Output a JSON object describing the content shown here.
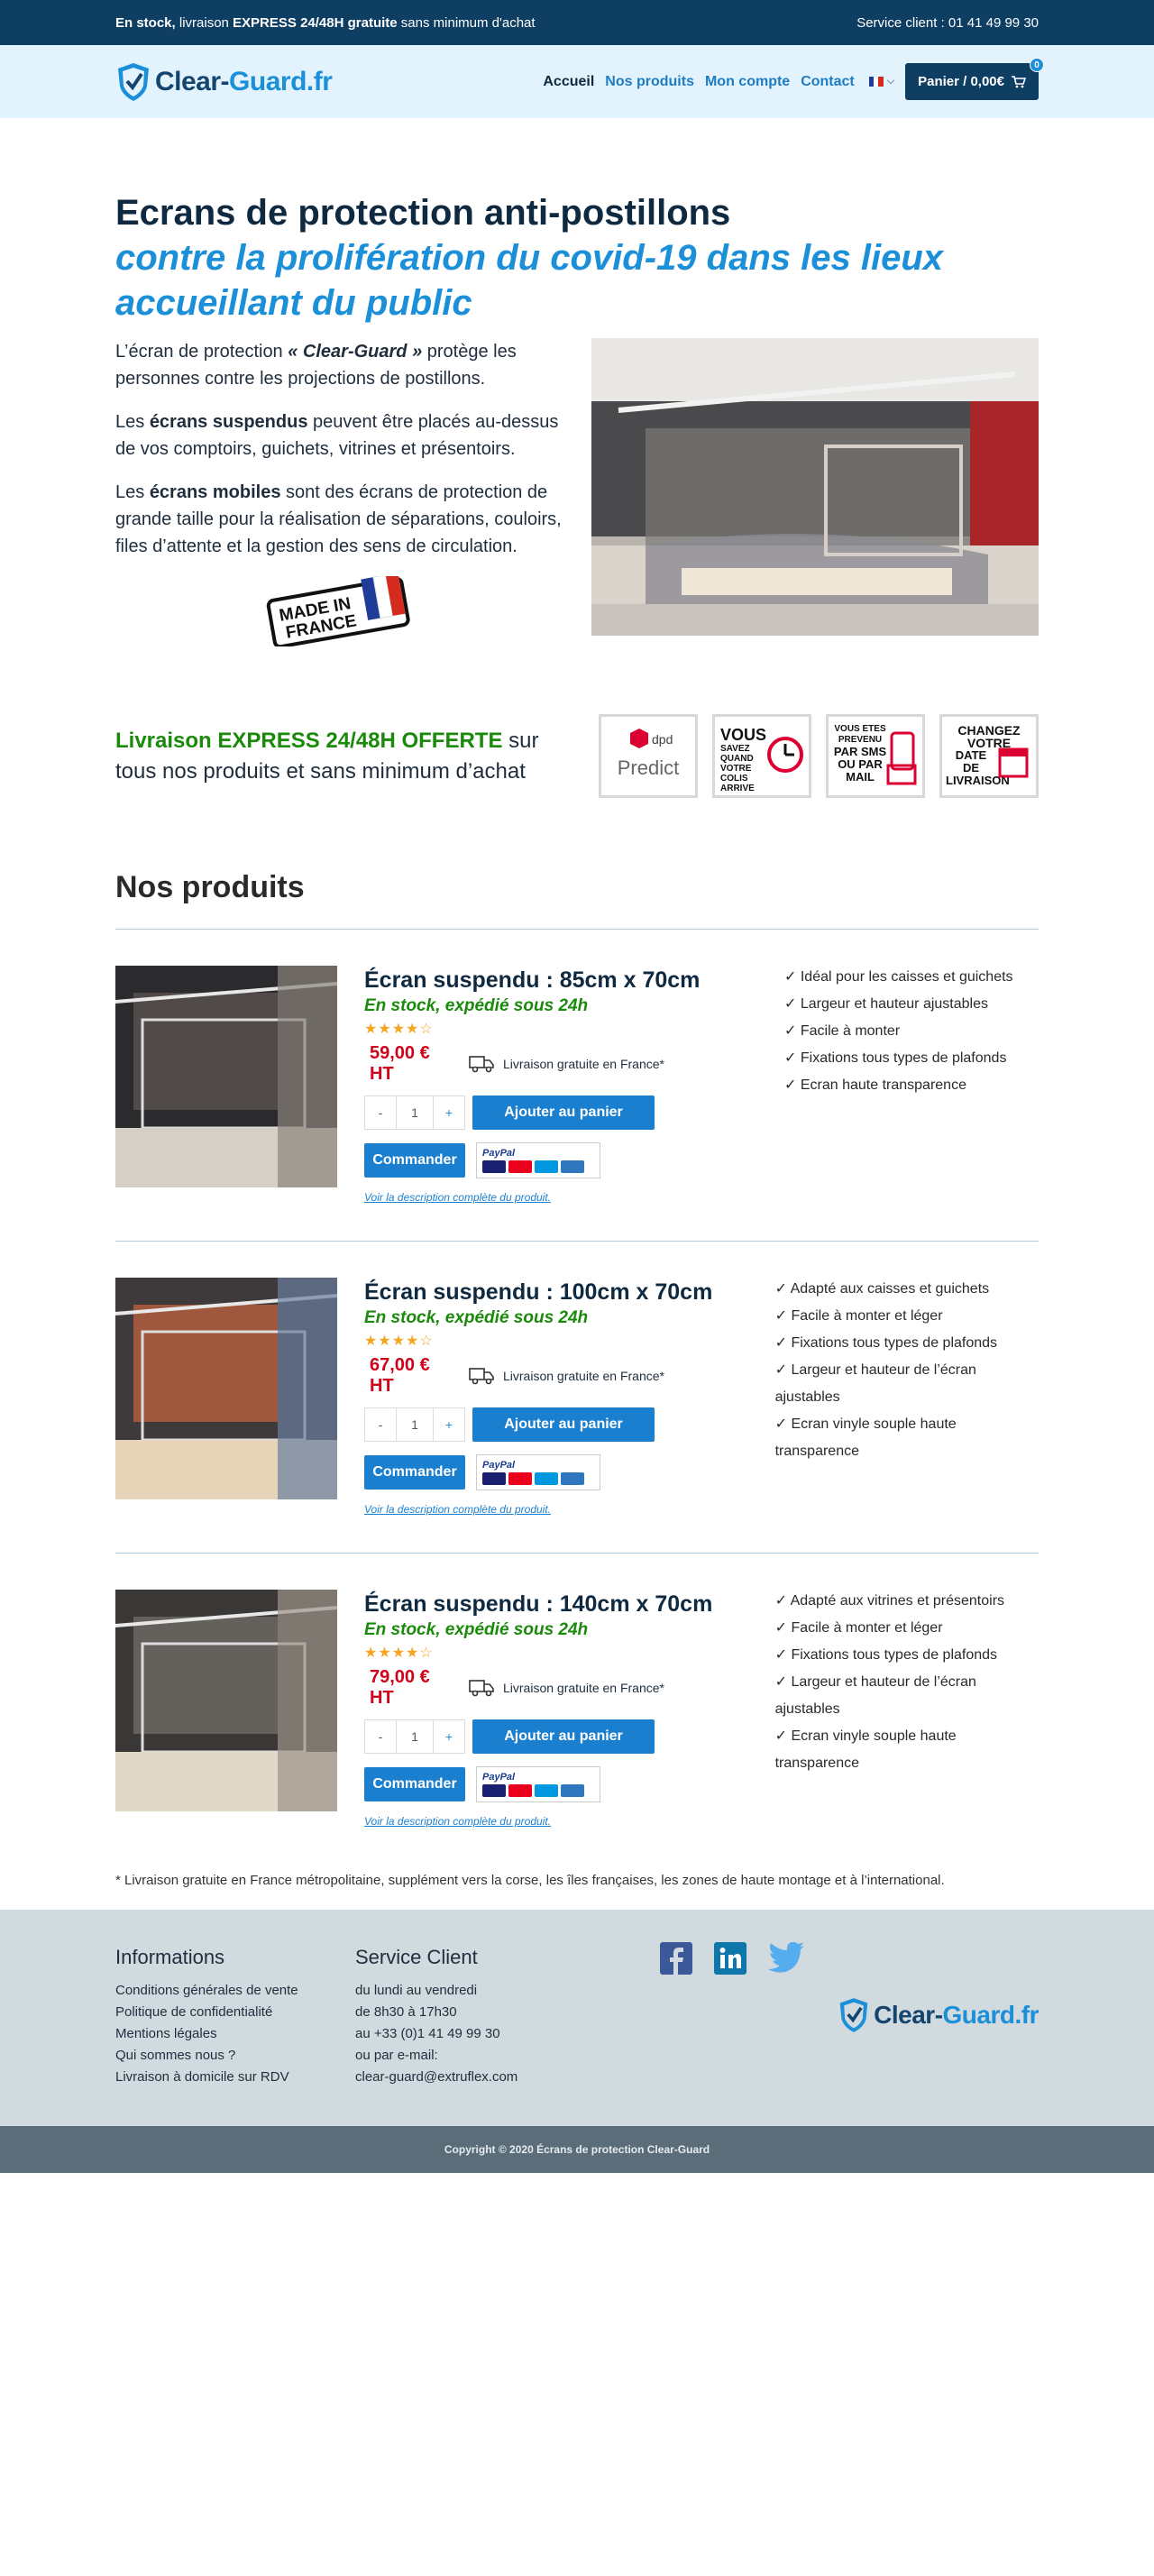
{
  "topbar": {
    "stock_bold": "En stock,",
    "stock_rest": " livraison ",
    "express": "EXPRESS 24/48H gratuite",
    "tail": " sans minimum d'achat",
    "service": "Service client : 01 41 49 99 30"
  },
  "header": {
    "logo_a": "Clear-",
    "logo_b": "Guard.fr",
    "nav": [
      "Accueil",
      "Nos produits",
      "Mon compte",
      "Contact"
    ],
    "cart_label": "Panier / 0,00€",
    "cart_count": "0"
  },
  "hero": {
    "title": "Ecrans de protection anti-postillons",
    "subtitle": "contre la prolifération du covid-19 dans les lieux accueillant du public",
    "p1_a": "L’écran de protection ",
    "p1_b": "« Clear-Guard »",
    "p1_c": " protège les personnes contre les projections de postillons.",
    "p2_a": "Les ",
    "p2_b": "écrans suspendus",
    "p2_c": " peuvent être placés au-dessus de vos comptoirs, guichets, vitrines et présentoirs.",
    "p3_a": "Les ",
    "p3_b": "écrans mobiles",
    "p3_c": " sont des écrans de protection de grande taille pour la réalisation de séparations, couloirs, files d’attente et la gestion des sens de circulation.",
    "madein_1": "MADE IN",
    "madein_2": "FRANCE"
  },
  "delivery": {
    "bold": "Livraison EXPRESS 24/48H OFFERTE",
    "rest": " sur tous nos produits et sans minimum d’achat",
    "badges": [
      {
        "l1": "dpd",
        "l2": "Predict"
      },
      {
        "l1": "VOUS",
        "l2": "SAVEZ QUAND VOTRE COLIS ARRIVE"
      },
      {
        "l1": "VOUS ETES PREVENU",
        "l2": "PAR SMS OU PAR MAIL"
      },
      {
        "l1": "CHANGEZ VOTRE",
        "l2": "DATE DE LIVRAISON"
      }
    ]
  },
  "products_title": "Nos produits",
  "products": [
    {
      "name": "Écran suspendu : 85cm x 70cm",
      "stock": "En stock, expédié sous 24h",
      "stars": "★★★★☆",
      "price": "59,00 € HT",
      "ship": "Livraison gratuite en France*",
      "qty": "1",
      "add": "Ajouter au panier",
      "order": "Commander",
      "link": "Voir la description complète du produit.",
      "features": [
        "Idéal pour les caisses et guichets",
        "Largeur et hauteur ajustables",
        "Facile à monter",
        "Fixations tous types de plafonds",
        "Ecran haute transparence"
      ]
    },
    {
      "name": "Écran suspendu : 100cm x 70cm",
      "stock": "En stock, expédié sous 24h",
      "stars": "★★★★☆",
      "price": "67,00 € HT",
      "ship": "Livraison gratuite en France*",
      "qty": "1",
      "add": "Ajouter au panier",
      "order": "Commander",
      "link": "Voir la description complète du produit.",
      "features": [
        "Adapté aux caisses et guichets",
        "Facile à monter et léger",
        "Fixations tous types de plafonds",
        "Largeur et hauteur de l’écran ajustables",
        "Ecran vinyle souple haute transparence"
      ]
    },
    {
      "name": "Écran suspendu : 140cm x 70cm",
      "stock": "En stock, expédié sous 24h",
      "stars": "★★★★☆",
      "price": "79,00 € HT",
      "ship": "Livraison gratuite en France*",
      "qty": "1",
      "add": "Ajouter au panier",
      "order": "Commander",
      "link": "Voir la description complète du produit.",
      "features": [
        "Adapté aux vitrines et présentoirs",
        "Facile à monter et léger",
        "Fixations tous types de plafonds",
        "Largeur et hauteur de l’écran ajustables",
        "Ecran vinyle souple haute transparence"
      ]
    }
  ],
  "qty_minus": "-",
  "qty_plus": "+",
  "paypal": "PayPal",
  "note": "* Livraison gratuite en France métropolitaine, supplément vers la corse, les îles françaises, les zones de haute montage et à l’international.",
  "footer": {
    "info_title": "Informations",
    "info_links": [
      "Conditions générales de vente",
      "Politique de confidentialité",
      "Mentions légales",
      "Qui sommes nous ?",
      "Livraison à domicile sur RDV"
    ],
    "service_title": "Service Client",
    "service_lines": [
      "du lundi au vendredi",
      "de 8h30 à 17h30",
      "au +33 (0)1 41 49 99 30",
      "ou par e-mail:",
      "clear-guard@extruflex.com"
    ],
    "logo_a": "Clear-",
    "logo_b": "Guard.fr"
  },
  "copyright": "Copyright © 2020 Écrans de protection Clear-Guard",
  "colors": {
    "navy": "#0f3e63",
    "accent": "#1b8fd8",
    "green": "#1a8a0a",
    "price_red": "#d0021b"
  }
}
